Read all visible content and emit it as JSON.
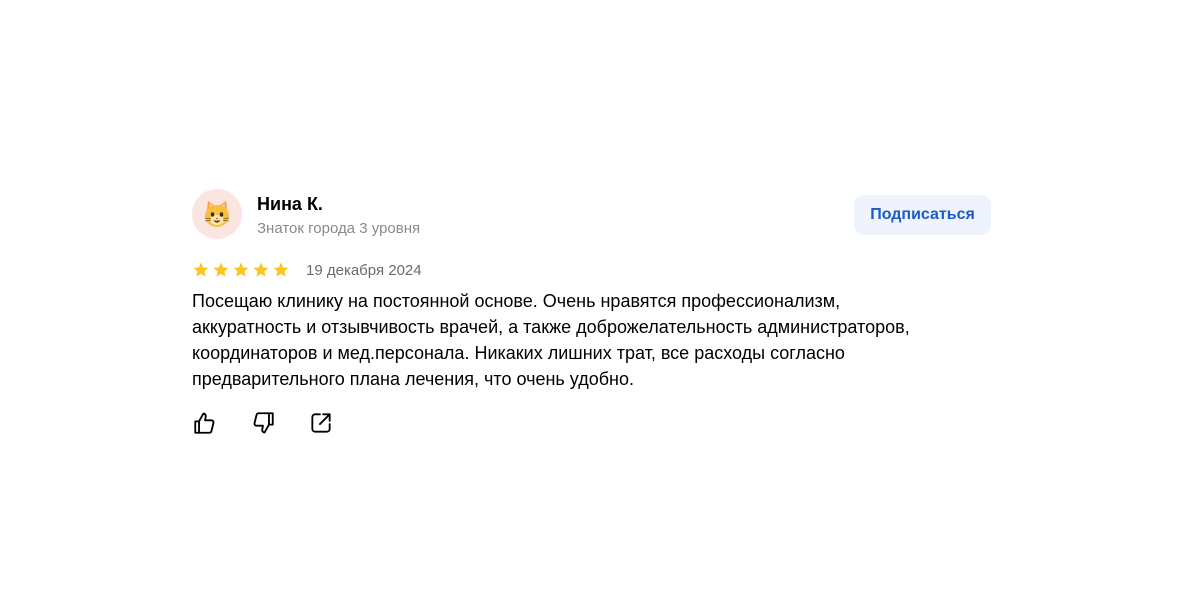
{
  "author": {
    "name": "Нина К.",
    "level": "Знаток города 3 уровня",
    "avatar_emoji": "😺"
  },
  "subscribe_label": "Подписаться",
  "rating": {
    "stars": 5,
    "max": 5,
    "color": "#fcc521"
  },
  "date": "19 декабря 2024",
  "review_text": "Посещаю клинику на постоянной основе. Очень нравятся профессионализм, аккуратность и отзывчивость врачей, а также доброжелательность администраторов, координаторов и мед.персонала. Никаких лишних трат, все расходы согласно предварительного плана лечения, что очень удобно.",
  "actions": {
    "like_icon": "thumbs-up-icon",
    "dislike_icon": "thumbs-down-icon",
    "share_icon": "share-icon"
  },
  "colors": {
    "accent": "#1a5cc8",
    "button_bg": "#eef3fd",
    "avatar_bg": "#fbe5e1",
    "muted": "#8a8a8a"
  }
}
